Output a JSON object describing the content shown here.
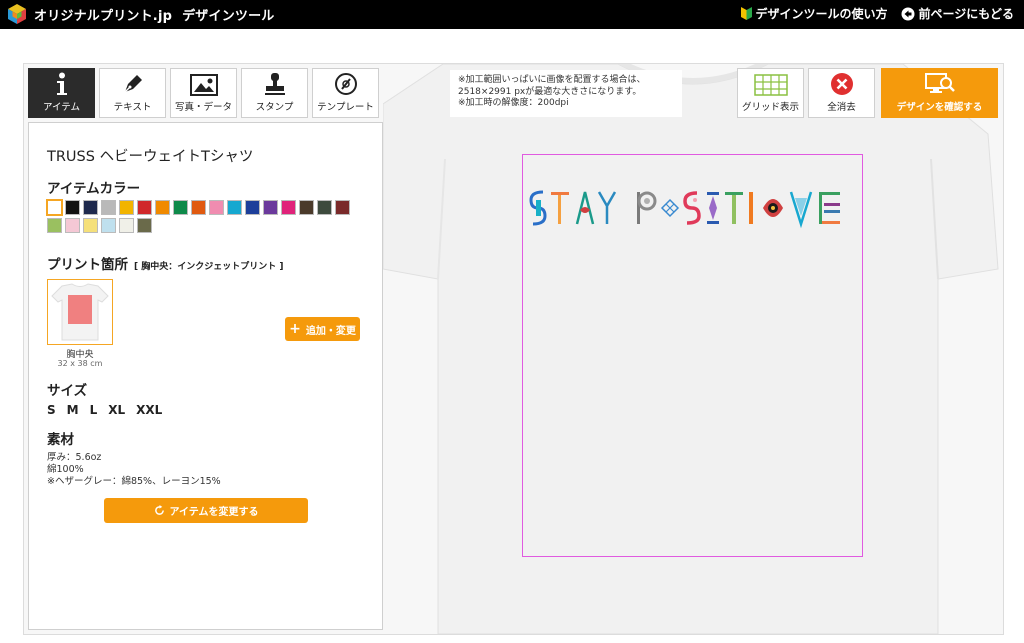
{
  "app": {
    "logo_text": "オリジナルプリント.jp",
    "logo_sub": "デザインツール",
    "help_link": "デザインツールの使い方",
    "back_link": "前ページにもどる"
  },
  "tabs": [
    {
      "label": "アイテム",
      "icon": "info-icon"
    },
    {
      "label": "テキスト",
      "icon": "pen-icon"
    },
    {
      "label": "写真・データ",
      "icon": "image-icon"
    },
    {
      "label": "スタンプ",
      "icon": "stamp-icon"
    },
    {
      "label": "テンプレート",
      "icon": "template-icon"
    }
  ],
  "item": {
    "title": "TRUSS ヘビーウェイトTシャツ",
    "color_heading": "アイテムカラー",
    "colors": [
      "#ffffff",
      "#111111",
      "#1f2a4d",
      "#b9b9b9",
      "#f2b400",
      "#d0282a",
      "#f08a00",
      "#0f8a4a",
      "#e05a10",
      "#f08cb0",
      "#16a8d0",
      "#1d3f9a",
      "#6b3a9c",
      "#e0237a",
      "#4a3a2a",
      "#3d4a3d",
      "#7a2a2a",
      "#9ac060",
      "#f5c8d5",
      "#f5e07a",
      "#bfe0ee",
      "#f0f0e8",
      "#6a6a4a"
    ],
    "selected_color": 0,
    "print_heading": "プリント箇所",
    "print_method": "[ 胸中央：インクジェットプリント ]",
    "location_label": "胸中央",
    "location_size": "32 x 38 cm",
    "add_button": "追加・変更",
    "size_heading": "サイズ",
    "sizes": [
      "S",
      "M",
      "L",
      "XL",
      "XXL"
    ],
    "material_heading": "素材",
    "material_lines": [
      "厚み：5.6oz",
      "綿100%",
      "※ヘザーグレー：綿85%、レーヨン15%"
    ],
    "change_button": "アイテムを変更する"
  },
  "notice": {
    "lines": [
      "※加工範囲いっぱいに画像を配置する場合は、",
      "2518×2991 pxが最適な大きさになります。",
      "※加工時の解像度：200dpi"
    ]
  },
  "toolbar": {
    "grid_label": "グリッド表示",
    "clear_label": "全消去",
    "confirm_label": "デザインを確認する"
  },
  "canvas": {
    "design_text": "STAY POSITIVE",
    "accent": "#f59a0c",
    "print_area_color": "#e05ae0"
  }
}
